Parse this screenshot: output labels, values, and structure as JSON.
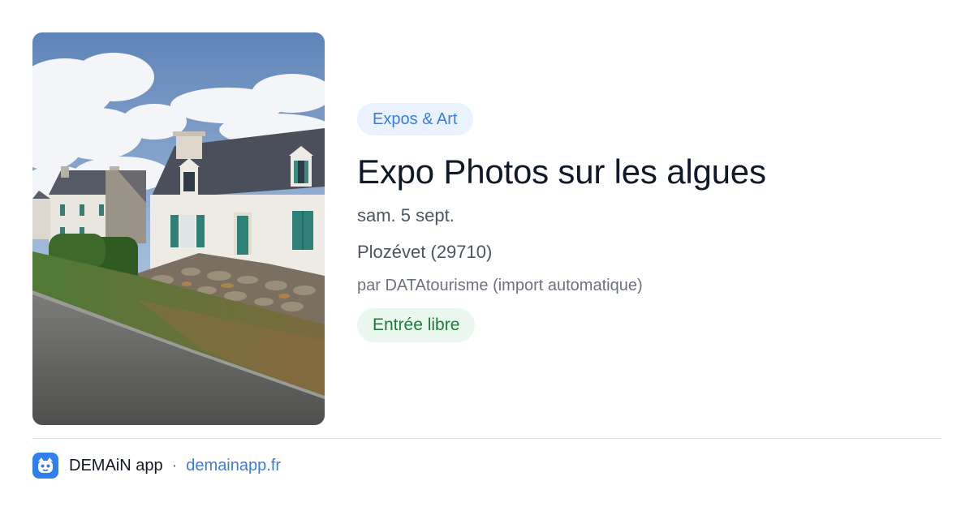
{
  "card": {
    "image_alt": "Maisons bretonnes en pierre le long d'une route",
    "category": "Expos & Art",
    "title": "Expo Photos sur les algues",
    "date": "sam. 5 sept.",
    "location": "Plozévet (29710)",
    "author": "par DATAtourisme (import automatique)",
    "price": "Entrée libre"
  },
  "footer": {
    "app_name": "DEMAiN app",
    "separator": "·",
    "domain": "demainapp.fr",
    "logo_icon": "app-logo-icon"
  },
  "colors": {
    "category_bg": "#eaf2fd",
    "category_text": "#3b7dd8",
    "price_bg": "#e9f7ee",
    "price_text": "#1f7a3d",
    "link": "#3b7dd8",
    "logo_bg": "#2f80ed"
  }
}
